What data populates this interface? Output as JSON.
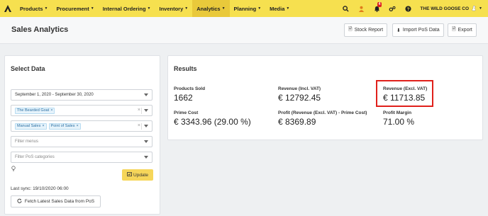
{
  "nav": {
    "items": [
      {
        "label": "Products",
        "active": false
      },
      {
        "label": "Procurement",
        "active": false
      },
      {
        "label": "Internal Ordering",
        "active": false
      },
      {
        "label": "Inventory",
        "active": false
      },
      {
        "label": "Analytics",
        "active": true
      },
      {
        "label": "Planning",
        "active": false
      },
      {
        "label": "Media",
        "active": false
      }
    ],
    "icons": [
      "search-icon",
      "user-icon",
      "bell-icon",
      "settings-icon",
      "help-icon"
    ],
    "notification_count": "4",
    "account_name": "THE WILD GOOSE CO"
  },
  "header": {
    "title": "Sales Analytics",
    "buttons": {
      "stock_report": "Stock Report",
      "import_pos": "Import PoS Data",
      "export": "Export"
    }
  },
  "select_data": {
    "title": "Select Data",
    "date_range": "September 1, 2020 - September 30, 2020",
    "locations": [
      "The Bearded Goat"
    ],
    "sales_types": [
      "Manual Sales",
      "Point of Sales"
    ],
    "filter_menus_placeholder": "Filter menus",
    "filter_pos_placeholder": "Filter PoS categories",
    "update_label": "Update",
    "last_sync": "Last sync: 19/10/2020 06:00",
    "fetch_label": "Fetch Latest Sales Data from PoS"
  },
  "results": {
    "title": "Results",
    "products_sold": {
      "label": "Products Sold",
      "value": "1662"
    },
    "revenue_incl": {
      "label": "Revenue (Incl. VAT)",
      "value": "€ 12792.45"
    },
    "revenue_excl": {
      "label": "Revenue (Excl. VAT)",
      "value": "€ 11713.85"
    },
    "prime_cost": {
      "label": "Prime Cost",
      "value": "€ 3343.96 (29.00 %)"
    },
    "profit": {
      "label": "Profit (Revenue (Excl. VAT) - Prime Cost)",
      "value": "€ 8369.89"
    },
    "margin": {
      "label": "Profit Margin",
      "value": "71.00 %"
    }
  },
  "colors": {
    "nav_bg": "#f6e04f",
    "nav_active": "#e9c93b",
    "update_btn": "#f6d65a",
    "highlight": "#e0201b"
  }
}
